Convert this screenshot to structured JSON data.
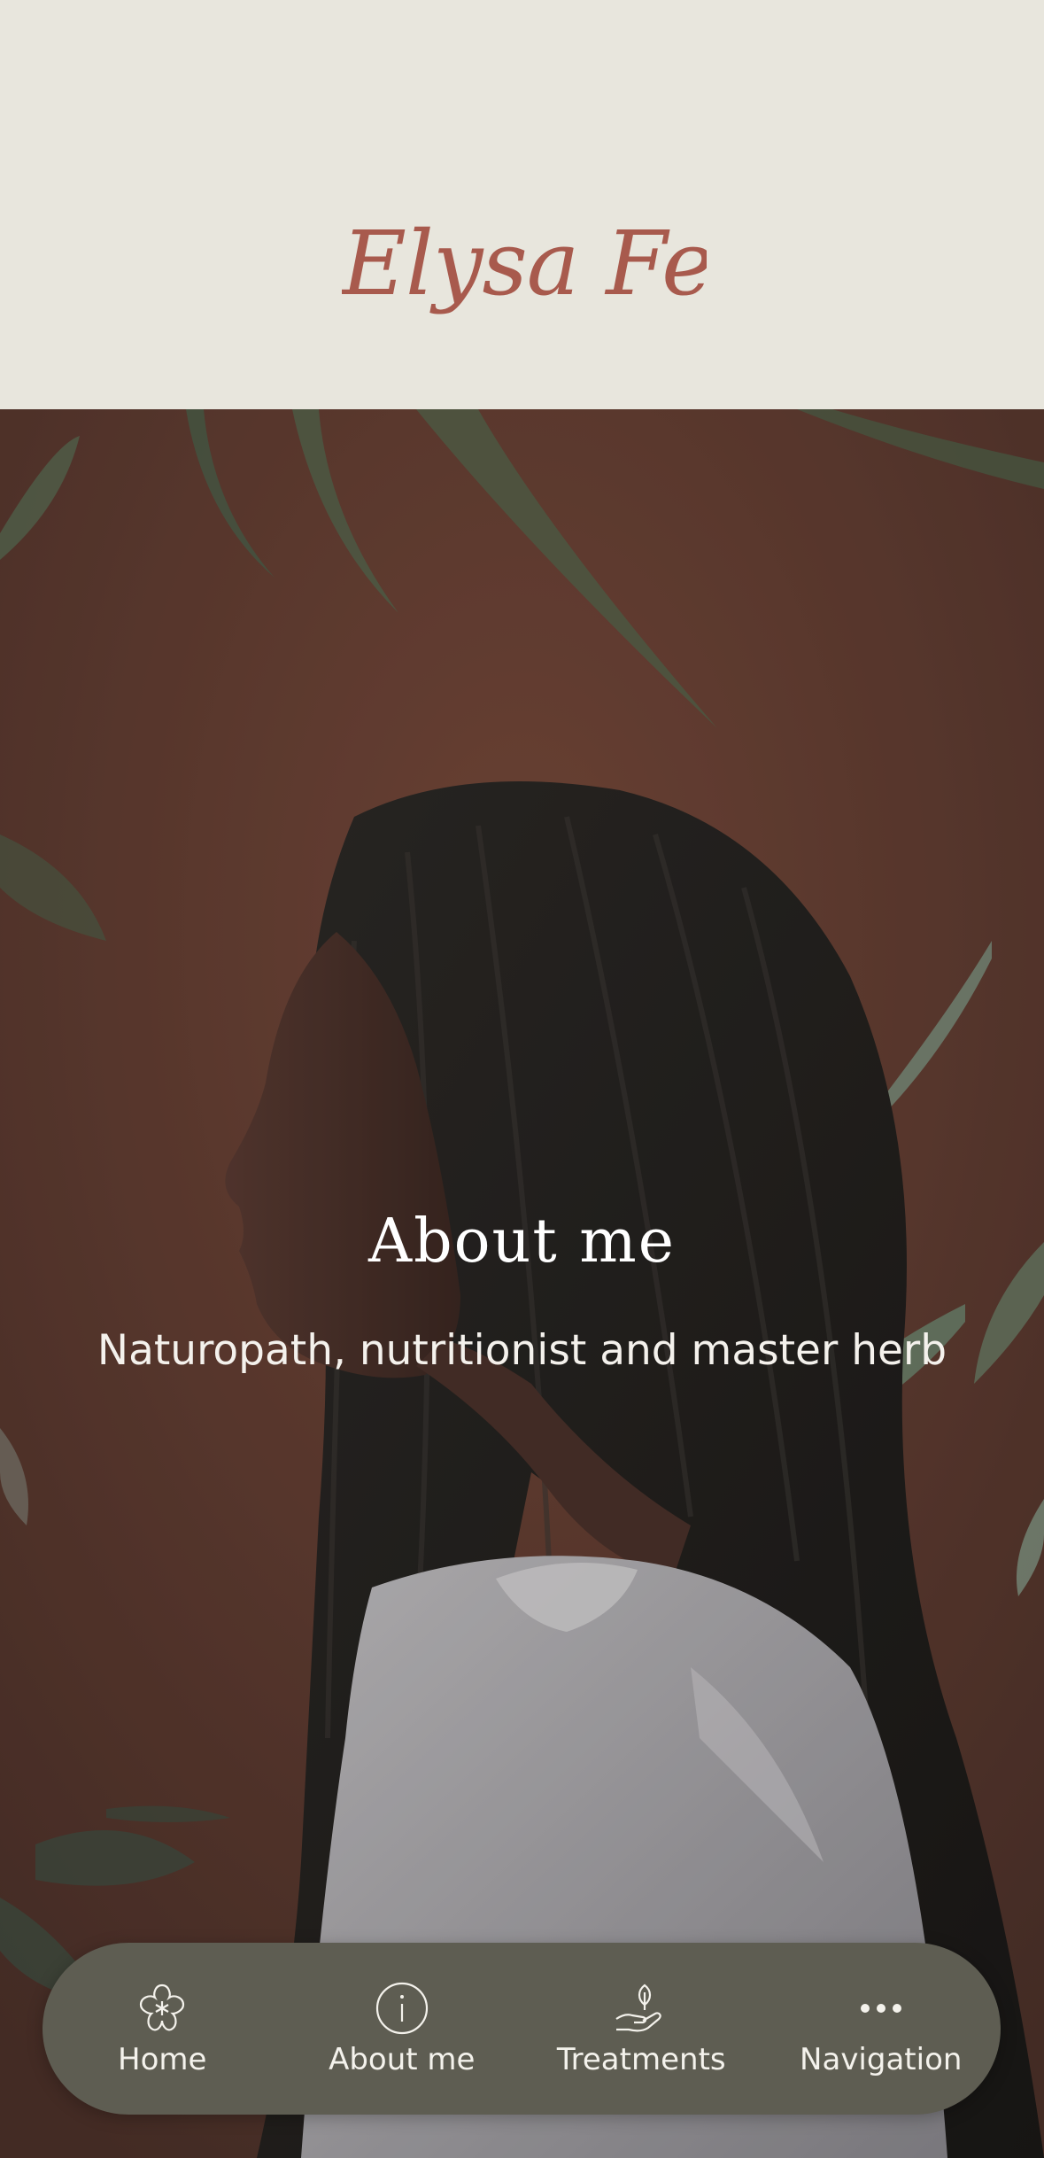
{
  "header": {
    "logo_text": "Elysa Feiger"
  },
  "hero": {
    "title": "About me",
    "subtitle": "Naturopath, nutritionist and master herb"
  },
  "bottom_nav": {
    "items": [
      {
        "label": "Home",
        "icon": "flower-icon"
      },
      {
        "label": "About me",
        "icon": "info-icon"
      },
      {
        "label": "Treatments",
        "icon": "hand-plant-icon"
      },
      {
        "label": "Navigation",
        "icon": "more-dots-icon"
      }
    ]
  },
  "colors": {
    "header_background": "#e8e6dd",
    "logo": "#a85a4d",
    "hero_background": "#6a4236",
    "navbar_background": "#5e5d52",
    "nav_text": "#f4f2ec"
  }
}
